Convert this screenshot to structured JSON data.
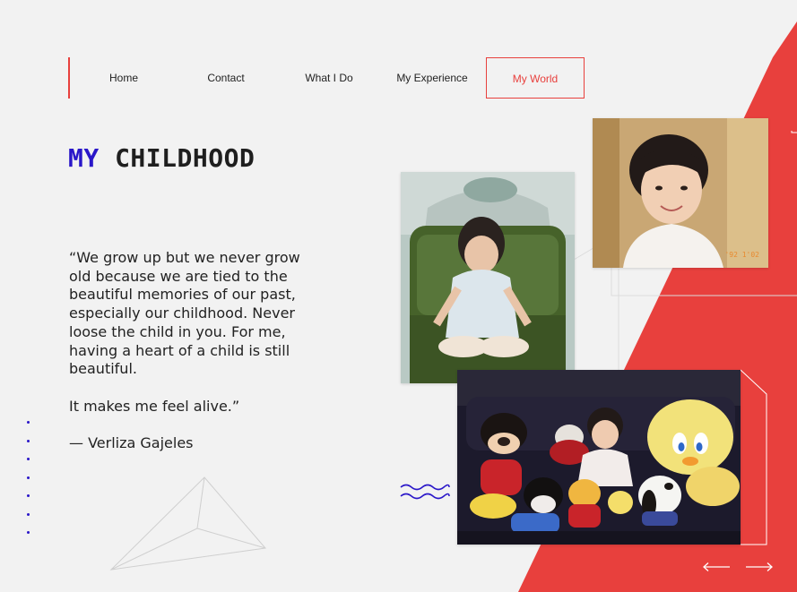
{
  "nav": {
    "items": [
      {
        "label": "Home"
      },
      {
        "label": "Contact"
      },
      {
        "label": "What I Do"
      },
      {
        "label": "My Experience"
      },
      {
        "label": "My World",
        "active": true
      }
    ]
  },
  "heading": {
    "accent": "MY",
    "rest": "CHILDHOOD"
  },
  "quote": {
    "text": "“We grow up but we never grow old because we are tied to the beautiful memories of our past, especially our childhood. Never loose the child in you. For me, having a heart of a child is still beautiful.",
    "closing": "It makes me feel alive.”"
  },
  "author": "— Verliza Gajeles",
  "photos": [
    {
      "name": "toddler-on-green-sofa-photo"
    },
    {
      "name": "smiling-girl-portrait-photo",
      "timestamp": "'92 1'02"
    },
    {
      "name": "child-with-plush-toys-photo"
    }
  ],
  "colors": {
    "accent_red": "#e8403d",
    "accent_blue": "#2a17c9",
    "background": "#f2f2f2"
  },
  "icons": {
    "prev": "arrow-left-icon",
    "next": "arrow-right-icon",
    "wave": "wave-icon"
  }
}
